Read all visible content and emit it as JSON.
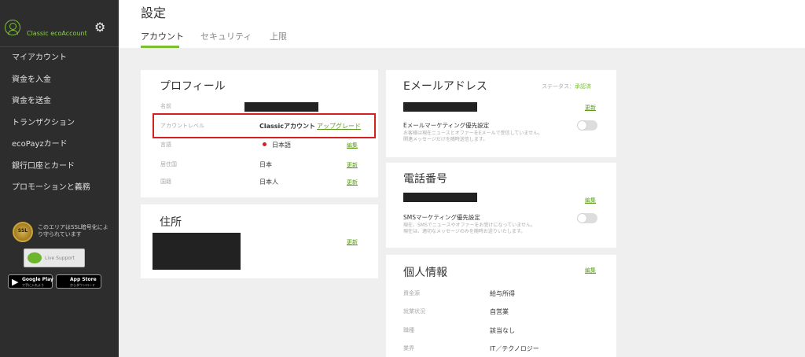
{
  "sidebar": {
    "account_name": "Classic ecoAccount",
    "items": [
      {
        "label": "マイアカウント"
      },
      {
        "label": "資金を入金"
      },
      {
        "label": "資金を送金"
      },
      {
        "label": "トランザクション"
      },
      {
        "label": "ecoPayzカード"
      },
      {
        "label": "銀行口座とカード"
      },
      {
        "label": "プロモーションと義務"
      }
    ],
    "ssl_text": "このエリアはSSL暗号化により守られています",
    "ssl_badge": "SSL",
    "live_support": "Live Support",
    "google_play": {
      "main": "Google Play",
      "sub": "で手に入れよう"
    },
    "app_store": {
      "main": "App Store",
      "sub": "からダウンロード"
    }
  },
  "header": {
    "title": "設定",
    "tabs": [
      {
        "label": "アカウント",
        "active": true
      },
      {
        "label": "セキュリティ",
        "active": false
      },
      {
        "label": "上限",
        "active": false
      }
    ]
  },
  "profile": {
    "title": "プロフィール",
    "rows": [
      {
        "label": "名前",
        "value": "",
        "action": ""
      },
      {
        "label": "アカウントレベル",
        "value": "Classicアカウント",
        "action": "アップグレード"
      },
      {
        "label": "言語",
        "value": "日本語",
        "action": "編集"
      },
      {
        "label": "居住国",
        "value": "日本",
        "action": "更新"
      },
      {
        "label": "国籍",
        "value": "日本人",
        "action": "更新"
      }
    ]
  },
  "address": {
    "title": "住所",
    "action": "更新"
  },
  "email": {
    "title": "Eメールアドレス",
    "status_label": "ステータス：",
    "status_value": "承認済",
    "action": "更新",
    "marketing_title": "Eメールマーケティング優先設定",
    "marketing_desc_1": "お客様は現在ニュースとオファーをEメールで受信していません。",
    "marketing_desc_2": "関連メッセージだけを随時送信します。",
    "toggle_on": false
  },
  "phone": {
    "title": "電話番号",
    "action": "編集",
    "sms_title": "SMSマーケティング優先設定",
    "sms_desc_1": "現在、SMSでニュースやオファーをお受けになっていません。",
    "sms_desc_2": "現在は、適切なメッセージのみを随時お送りいたします。",
    "toggle_on": false
  },
  "personal": {
    "title": "個人情報",
    "action": "編集",
    "rows": [
      {
        "label": "資金源",
        "value": "給与所得"
      },
      {
        "label": "就業状況",
        "value": "自営業"
      },
      {
        "label": "職種",
        "value": "該当なし"
      },
      {
        "label": "業界",
        "value": "IT／テクノロジー"
      }
    ]
  },
  "colors": {
    "sidebar_bg": "#2d2d2d",
    "accent_green": "#7cbf2f",
    "highlight_red": "#d32020"
  }
}
